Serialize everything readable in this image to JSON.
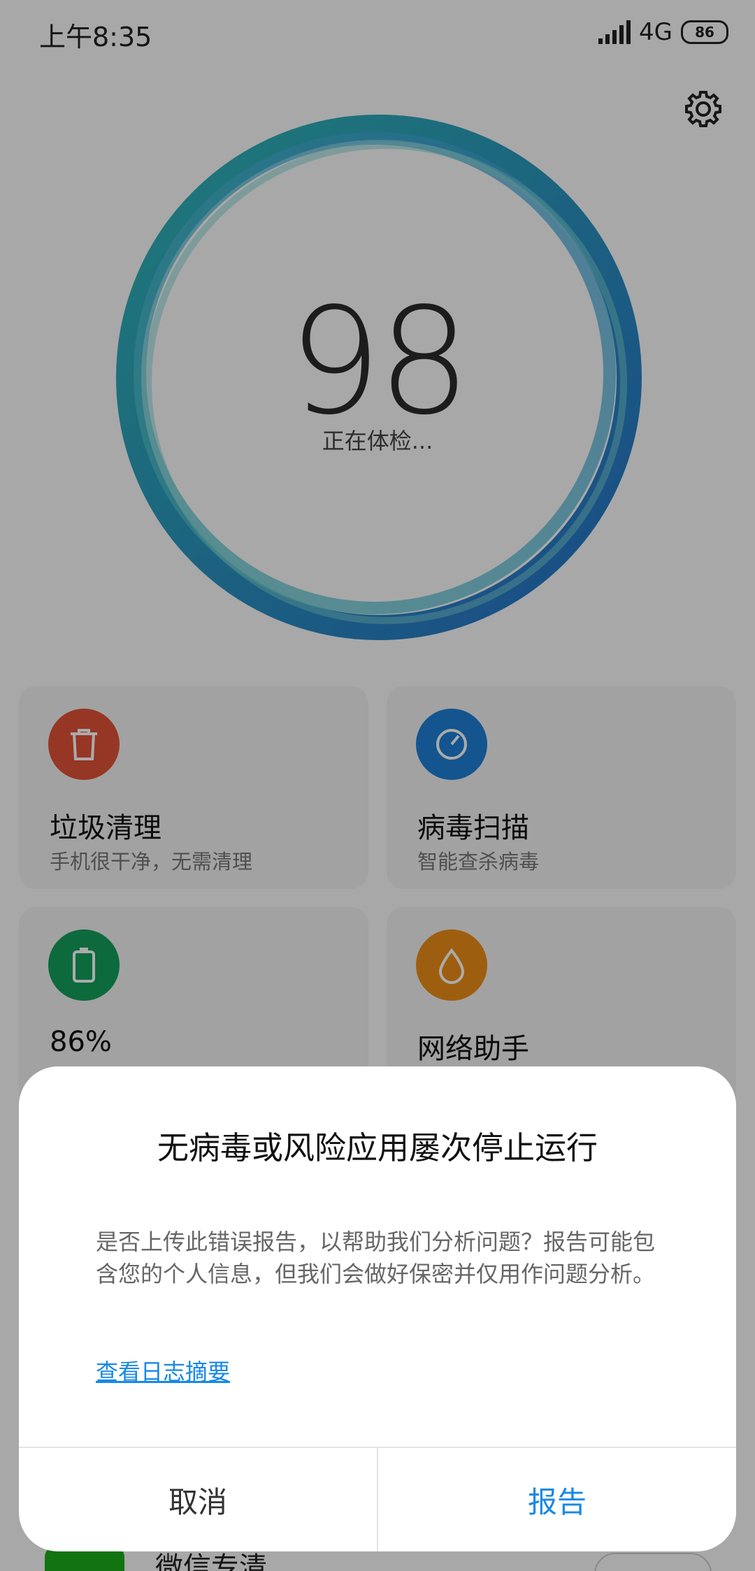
{
  "status_bar": {
    "time": "上午8:35",
    "network": "4G",
    "battery": "86"
  },
  "scan": {
    "score": "98",
    "status": "正在体检..."
  },
  "cards": [
    {
      "title": "垃圾清理",
      "subtitle": "手机很干净，无需清理",
      "color": "#e0533a",
      "icon": "trash-icon"
    },
    {
      "title": "病毒扫描",
      "subtitle": "智能查杀病毒",
      "color": "#1e7fd6",
      "icon": "gauge-icon"
    },
    {
      "title": "86%",
      "subtitle": "",
      "color": "#139e5c",
      "icon": "battery-icon"
    },
    {
      "title": "网络助手",
      "subtitle": "",
      "color": "#ec8c17",
      "icon": "droplet-icon"
    }
  ],
  "bottom_item": {
    "title": "微信专清"
  },
  "dialog": {
    "title": "无病毒或风险应用屡次停止运行",
    "message": "是否上传此错误报告，以帮助我们分析问题？报告可能包含您的个人信息，但我们会做好保密并仅用作问题分析。",
    "link": "查看日志摘要",
    "cancel": "取消",
    "report": "报告"
  },
  "colors": {
    "ring_teal": "#2eb3b6",
    "ring_blue": "#2a7dd1",
    "accent": "#1789e6"
  }
}
